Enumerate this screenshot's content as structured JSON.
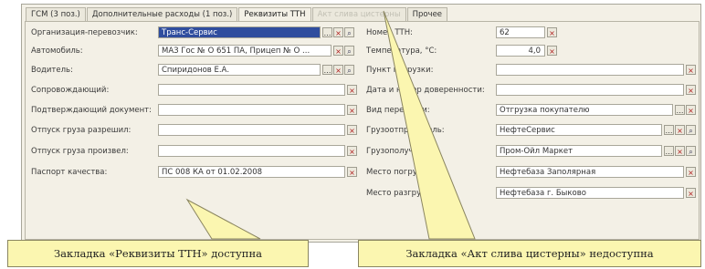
{
  "tabs": [
    {
      "label": "ГСМ (3 поз.)",
      "state": "normal"
    },
    {
      "label": "Дополнительные расходы (1 поз.)",
      "state": "normal"
    },
    {
      "label": "Реквизиты ТТН",
      "state": "active"
    },
    {
      "label": "Акт слива цистерны",
      "state": "disabled"
    },
    {
      "label": "Прочее",
      "state": "normal"
    }
  ],
  "left_fields": [
    {
      "label": "Организация-перевозчик:",
      "value": "Транс-Сервис",
      "selected": true,
      "buttons": [
        "...",
        "x",
        "q"
      ]
    },
    {
      "label": "Автомобиль:",
      "value": "МАЗ Гос № О 651 ПА, Прицеп № О ...",
      "selected": false,
      "buttons": [
        "x",
        "q"
      ]
    },
    {
      "label": "Водитель:",
      "value": "Спиридонов Е.А.",
      "selected": false,
      "buttons": [
        "...",
        "x",
        "q"
      ]
    },
    {
      "label": "Сопровождающий:",
      "value": "",
      "selected": false,
      "buttons": [
        "x"
      ]
    },
    {
      "label": "Подтверждающий документ:",
      "value": "",
      "selected": false,
      "buttons": [
        "x"
      ]
    },
    {
      "label": "Отпуск груза разрешил:",
      "value": "",
      "selected": false,
      "buttons": [
        "x"
      ]
    },
    {
      "label": "Отпуск груза произвел:",
      "value": "",
      "selected": false,
      "buttons": [
        "x"
      ]
    },
    {
      "label": "Паспорт качества:",
      "value": "ПС 008 КА от 01.02.2008",
      "selected": false,
      "buttons": [
        "x"
      ]
    }
  ],
  "right_fields": [
    {
      "label": "Номер ТТН:",
      "value": "62",
      "buttons": [
        "x"
      ],
      "numeric": false
    },
    {
      "label": "Температура, °С:",
      "value": "4,0",
      "buttons": [
        "x"
      ],
      "numeric": true
    },
    {
      "label": "Пункт погрузки:",
      "value": "",
      "buttons": [
        "x"
      ],
      "numeric": false
    },
    {
      "label": "Дата и номер доверенности:",
      "value": "",
      "buttons": [
        "x"
      ],
      "numeric": false
    },
    {
      "label": "Вид перевозки:",
      "value": "Отгрузка покупателю",
      "buttons": [
        "...",
        "x"
      ],
      "numeric": false
    },
    {
      "label": "Грузоотправитель:",
      "value": "НефтеСервис",
      "buttons": [
        "...",
        "x",
        "q"
      ],
      "numeric": false
    },
    {
      "label": "Грузополучатель:",
      "value": "Пром-Ойл Маркет",
      "buttons": [
        "...",
        "x",
        "q"
      ],
      "numeric": false
    },
    {
      "label": "Место погрузки:",
      "value": "Нефтебаза Заполярная",
      "buttons": [
        "x"
      ],
      "numeric": false
    },
    {
      "label": "Место разгрузки:",
      "value": "Нефтебаза г. Быково",
      "buttons": [
        "x"
      ],
      "numeric": false
    }
  ],
  "callouts": {
    "left": "Закладка «Реквизиты ТТН» доступна",
    "right": "Закладка «Акт слива цистерны» недоступна"
  },
  "colors": {
    "callout_fill": "#fbf6b0",
    "selection": "#2f4d9e",
    "window_bg": "#f3f0e6"
  }
}
